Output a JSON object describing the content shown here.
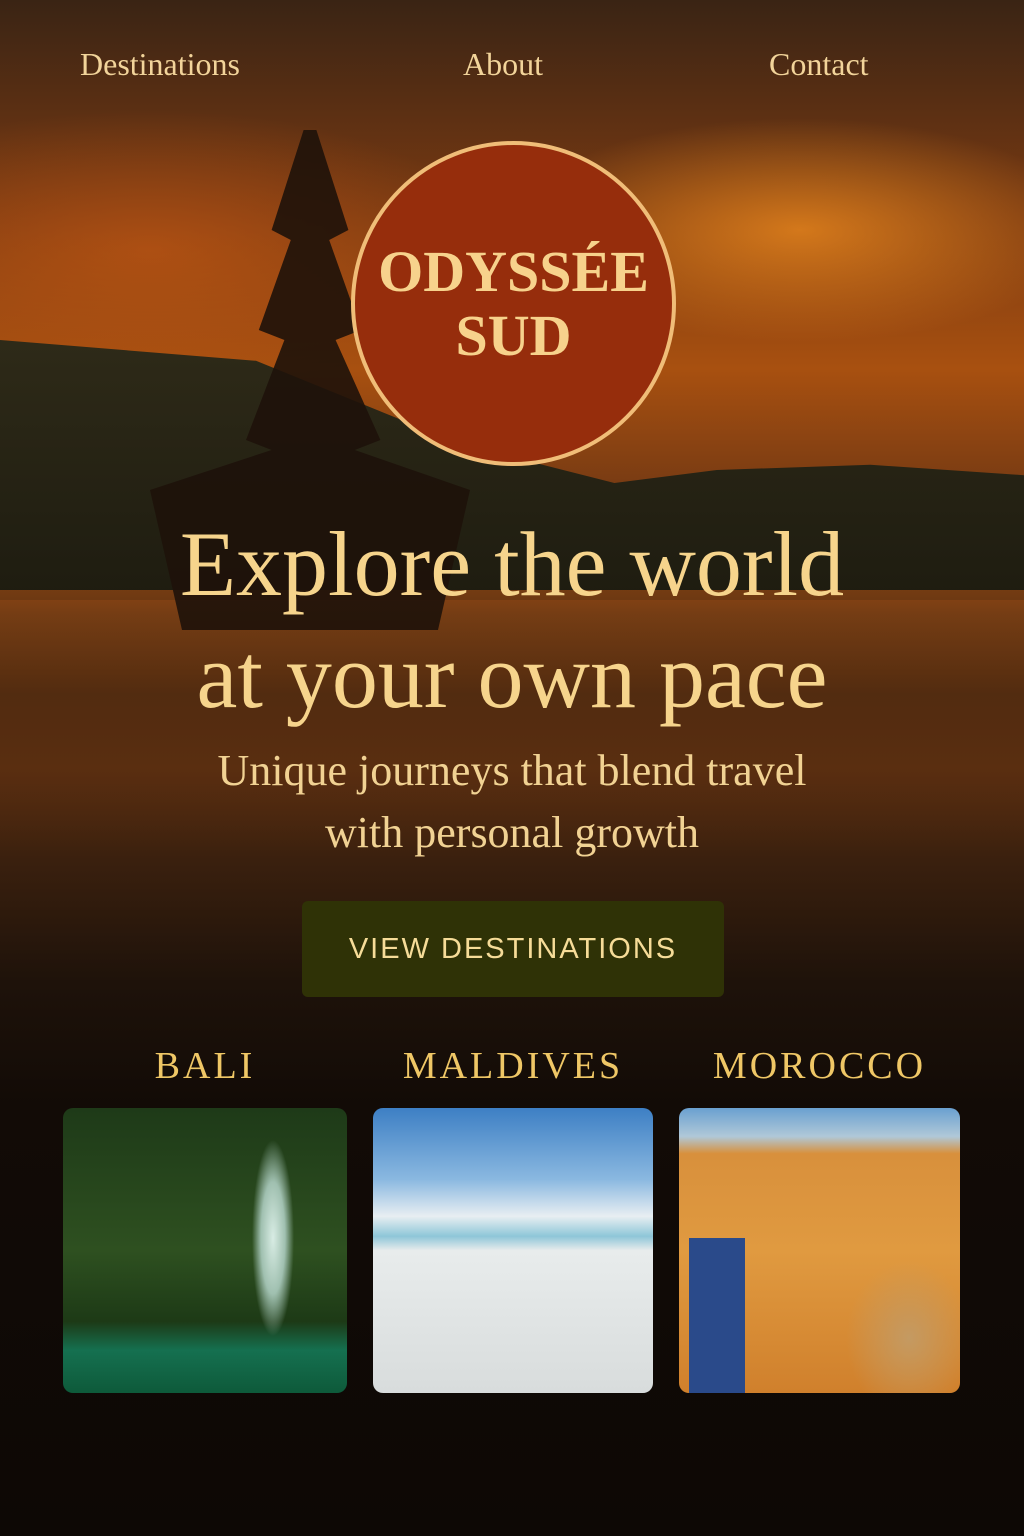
{
  "nav": {
    "items": [
      "Destinations",
      "About",
      "Contact"
    ]
  },
  "logo": {
    "line1": "ODYSSÉE",
    "line2": "SUD"
  },
  "hero": {
    "title_line1": "Explore the world",
    "title_line2": "at your own pace",
    "subtitle_line1": "Unique journeys that blend travel",
    "subtitle_line2": "with personal growth",
    "cta": "VIEW DESTINATIONS"
  },
  "destinations": [
    {
      "name": "BALI"
    },
    {
      "name": "MALDIVES"
    },
    {
      "name": "MOROCCO"
    }
  ],
  "colors": {
    "accent": "#962d0c",
    "gold": "#f6d48c",
    "button": "#2f3206"
  }
}
